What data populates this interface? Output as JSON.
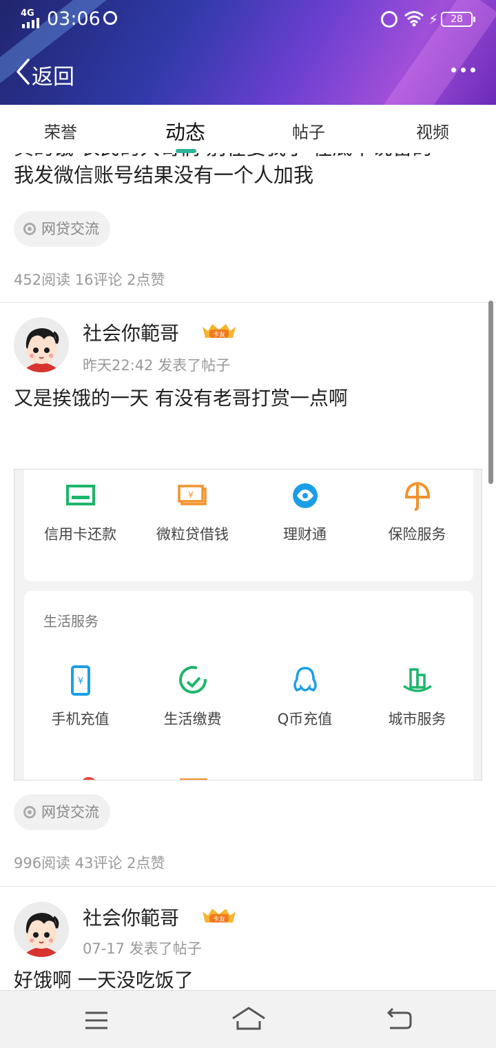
{
  "status_bar": {
    "network": "4G",
    "time": "03:06",
    "battery": "28"
  },
  "nav": {
    "back_label": "返回"
  },
  "tabs": [
    {
      "label": "荣誉",
      "active": false
    },
    {
      "label": "动态",
      "active": true
    },
    {
      "label": "帖子",
      "active": false
    },
    {
      "label": "视频",
      "active": false
    }
  ],
  "accent_color": "#2bb39a",
  "feed": {
    "partial_post": {
      "text_line1": "真的饿 农民的大哥们 别在要我了 在底下说留的",
      "text_line2": "我发微信账号结果没有一个人加我",
      "tag": "网贷交流",
      "stats": "452阅读 16评论 2点赞"
    },
    "post1": {
      "username": "社会你範哥",
      "badge": "卡友",
      "meta": "昨天22:42 发表了帖子",
      "text": "又是挨饿的一天 有没有老哥打赏一点啊",
      "image": {
        "row1": [
          "信用卡还款",
          "微粒贷借钱",
          "理财通",
          "保险服务"
        ],
        "section_title": "生活服务",
        "row2": [
          "手机充值",
          "生活缴费",
          "Q币充值",
          "城市服务"
        ]
      },
      "tag": "网贷交流",
      "stats": "996阅读 43评论 2点赞"
    },
    "post2": {
      "username": "社会你範哥",
      "badge": "卡友",
      "meta": "07-17 发表了帖子",
      "text": "好饿啊 一天没吃饭了"
    }
  }
}
